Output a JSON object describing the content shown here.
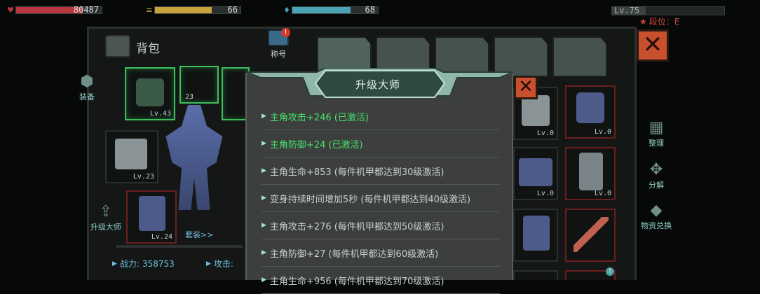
{
  "hud": {
    "hp": {
      "icon": "heart-icon",
      "value": "80487",
      "fill": 0.78,
      "color": "#b8363d"
    },
    "energy": {
      "icon": "battery-icon",
      "value": "66",
      "fill": 0.66,
      "color": "#c9a23a"
    },
    "water": {
      "icon": "drop-icon",
      "value": "68",
      "fill": 0.68,
      "color": "#4aa3b5"
    },
    "level": {
      "label": "Lv.75",
      "fill": 0.3
    },
    "rank": {
      "label": "段位：E"
    }
  },
  "backpack": {
    "title": "背包",
    "title_badge": "称号",
    "side_left": [
      {
        "label": "装备"
      },
      {
        "label": "升级大师"
      }
    ],
    "side_right": [
      {
        "label": "整理"
      },
      {
        "label": "分解"
      },
      {
        "label": "物资兑换"
      }
    ],
    "equipped_slots": [
      {
        "lv": "Lv.43"
      },
      {
        "lv": "23"
      },
      {
        "lv": ""
      },
      {
        "lv": "Lv.23"
      },
      {
        "lv": "Lv.24"
      }
    ],
    "set_link": "套装>>",
    "stats": [
      {
        "label": "战力:",
        "value": "358753"
      },
      {
        "label": "攻击:",
        "value": ""
      }
    ],
    "grid_slots": [
      {
        "lv": "Lv.0"
      },
      {
        "lv": "Lv.0"
      },
      {
        "lv": "Lv.0"
      },
      {
        "lv": "Lv.0"
      },
      {
        "lv": ""
      },
      {
        "lv": ""
      }
    ]
  },
  "dialog": {
    "title": "升级大师",
    "bonuses": [
      {
        "text": "主角攻击+246 (已激活)",
        "active": true
      },
      {
        "text": "主角防御+24 (已激活)",
        "active": true
      },
      {
        "text": "主角生命+853 (每件机甲都达到30级激活)",
        "active": false
      },
      {
        "text": "变身持续时间增加5秒 (每件机甲都达到40级激活)",
        "active": false
      },
      {
        "text": "主角攻击+276 (每件机甲都达到50级激活)",
        "active": false
      },
      {
        "text": "主角防御+27 (每件机甲都达到60级激活)",
        "active": false
      },
      {
        "text": "主角生命+956 (每件机甲都达到70级激活)",
        "active": false
      }
    ]
  }
}
